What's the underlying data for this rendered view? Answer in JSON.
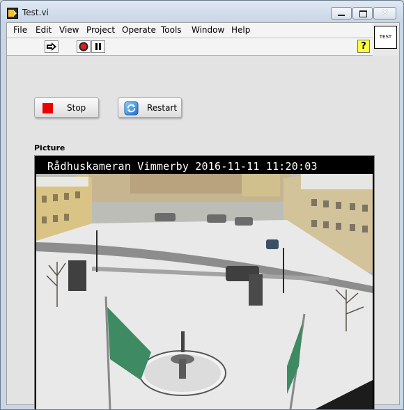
{
  "window": {
    "title": "Test.vi"
  },
  "menu": [
    "File",
    "Edit",
    "View",
    "Project",
    "Operate",
    "Tools",
    "Window",
    "Help"
  ],
  "toolbar": {
    "help_glyph": "?"
  },
  "vi_icon": {
    "label": "TEST"
  },
  "controls": {
    "stop_label": "Stop",
    "restart_label": "Restart"
  },
  "picture": {
    "label": "Picture",
    "caption": "Rådhuskameran Vimmerby 2016-11-11 11:20:03"
  },
  "colors": {
    "stop_red": "#ee0000",
    "help_yellow": "#ffff40"
  },
  "icons": [
    "labview-vi-icon",
    "run-arrow-icon",
    "abort-icon",
    "pause-icon",
    "help-icon",
    "restart-icon"
  ]
}
